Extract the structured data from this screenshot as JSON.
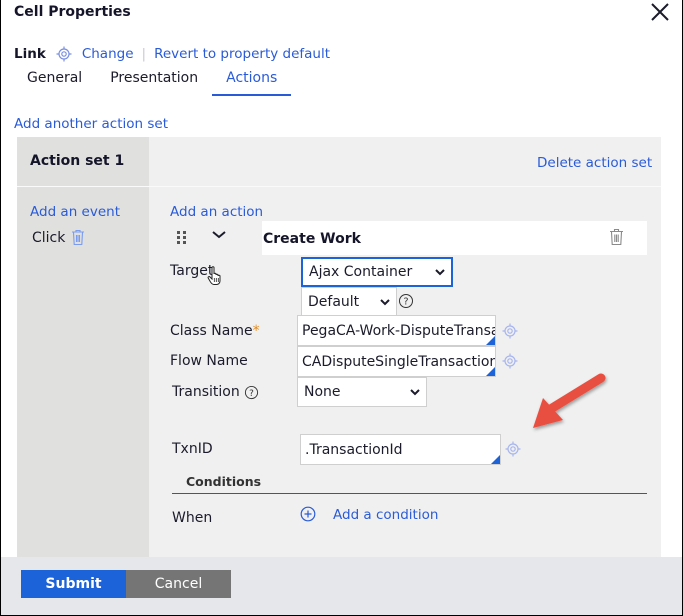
{
  "dialog": {
    "title": "Cell Properties",
    "close_icon": "close-icon"
  },
  "link_row": {
    "label": "Link",
    "icon": "target-icon",
    "change": "Change",
    "separator": "|",
    "revert": "Revert to property default"
  },
  "tabs": [
    {
      "label": "General",
      "active": false
    },
    {
      "label": "Presentation",
      "active": false
    },
    {
      "label": "Actions",
      "active": true
    }
  ],
  "actions": {
    "add_another_set": "Add another action set",
    "action_set": {
      "title": "Action set 1",
      "delete": "Delete action set",
      "add_event": "Add an event",
      "event": "Click",
      "add_action": "Add an action",
      "action": {
        "title": "Create Work",
        "fields": {
          "target": {
            "label": "Target",
            "value": "Ajax Container",
            "sub_value": "Default"
          },
          "class_name": {
            "label": "Class Name",
            "required_mark": "*",
            "value": "PegaCA-Work-DisputeTransac"
          },
          "flow_name": {
            "label": "Flow Name",
            "value": "CADisputeSingleTransaction"
          },
          "transition": {
            "label": "Transition",
            "value": "None"
          },
          "txnid": {
            "label": "TxnID",
            "value": ".TransactionId"
          }
        },
        "conditions": {
          "heading": "Conditions",
          "when_label": "When",
          "add_condition": "Add a condition"
        }
      }
    }
  },
  "footer": {
    "submit": "Submit",
    "cancel": "Cancel"
  },
  "colors": {
    "accent": "#1c62d8",
    "link": "#2a5bd7",
    "annotation_arrow": "#e8503f",
    "cancel_bg": "#757575"
  }
}
